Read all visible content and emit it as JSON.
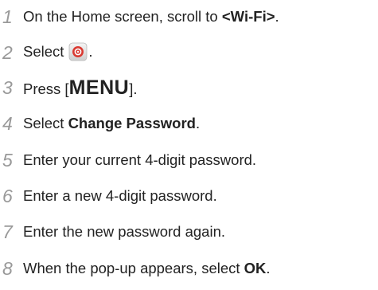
{
  "steps": [
    {
      "number": "1",
      "text_before": "On the Home screen, scroll to ",
      "bold": "<Wi-Fi>",
      "text_after": "."
    },
    {
      "number": "2",
      "text_before": "Select",
      "icon": "settings-app-icon",
      "text_after": "."
    },
    {
      "number": "3",
      "text_before": "Press [",
      "key": "MENU",
      "text_after": "]."
    },
    {
      "number": "4",
      "text_before": "Select ",
      "bold": "Change Password",
      "text_after": "."
    },
    {
      "number": "5",
      "text": "Enter your current 4-digit password."
    },
    {
      "number": "6",
      "text": "Enter a new 4-digit password."
    },
    {
      "number": "7",
      "text": "Enter the new password again."
    },
    {
      "number": "8",
      "text_before": "When the pop-up appears, select ",
      "bold": "OK",
      "text_after": "."
    }
  ],
  "colors": {
    "step_number": "#999999",
    "text": "#222222",
    "icon_red": "#d93a32"
  }
}
